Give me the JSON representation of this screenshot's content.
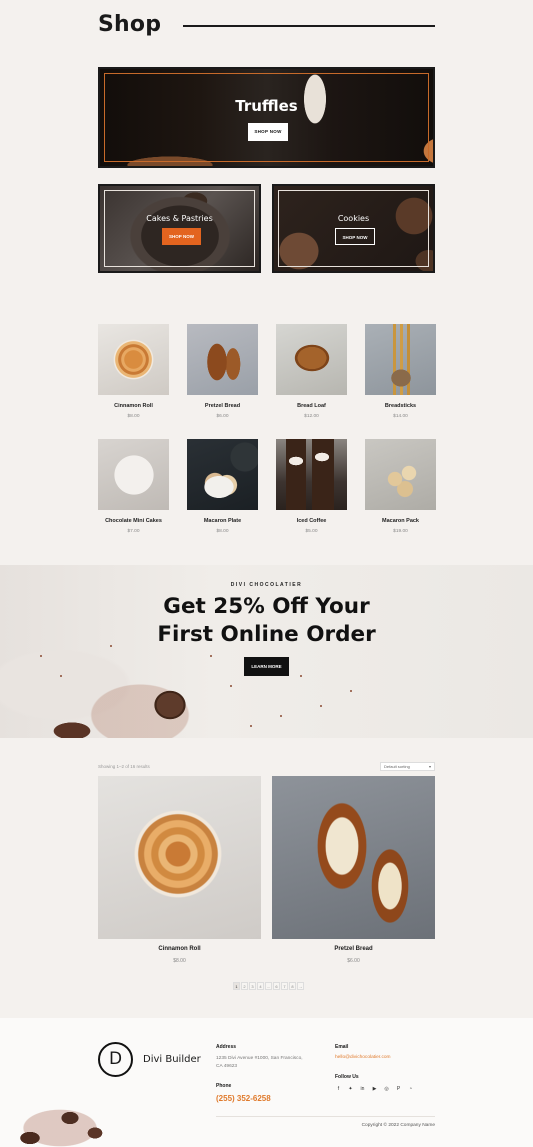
{
  "header": {
    "title": "Shop"
  },
  "banners": {
    "truffles": {
      "title": "Truffles",
      "button": "SHOP NOW"
    },
    "cakes": {
      "title": "Cakes & Pastries",
      "button": "SHOP NOW"
    },
    "cookies": {
      "title": "Cookies",
      "button": "SHOP NOW"
    }
  },
  "products": [
    {
      "name": "Cinnamon Roll",
      "price": "$8.00",
      "image": "cinnamon-roll"
    },
    {
      "name": "Pretzel Bread",
      "price": "$6.00",
      "image": "pretzel-bread"
    },
    {
      "name": "Bread Loaf",
      "price": "$12.00",
      "image": "bread-loaf"
    },
    {
      "name": "Breadsticks",
      "price": "$14.00",
      "image": "breadsticks"
    },
    {
      "name": "Chocolate Mini Cakes",
      "price": "$7.00",
      "image": "chocolate-mini-cakes"
    },
    {
      "name": "Macaron Plate",
      "price": "$8.00",
      "image": "macaron-plate"
    },
    {
      "name": "Iced Coffee",
      "price": "$5.00",
      "image": "iced-coffee"
    },
    {
      "name": "Macaron Pack",
      "price": "$19.00",
      "image": "macaron-pack"
    }
  ],
  "promo": {
    "kicker": "DIVI CHOCOLATIER",
    "headline_line1": "Get 25% Off Your",
    "headline_line2": "First Online Order",
    "button": "LEARN MORE"
  },
  "shop": {
    "result_count": "Showing 1–2 of 16 results",
    "sort_selected": "Default sorting",
    "items": [
      {
        "name": "Cinnamon Roll",
        "price": "$8.00"
      },
      {
        "name": "Pretzel Bread",
        "price": "$6.00"
      }
    ],
    "pagination": [
      "1",
      "2",
      "3",
      "4",
      "…",
      "6",
      "7",
      "8",
      "→"
    ],
    "current_page": "1"
  },
  "footer": {
    "logo_letter": "D",
    "brand": "Divi Builder",
    "address_heading": "Address",
    "address_line1": "1235 Divi Avenue #1000, San Francisco,",
    "address_line2": "CA 49623",
    "phone_heading": "Phone",
    "phone": "(255) 352-6258",
    "email_heading": "Email",
    "email": "hello@divichocolatier.com",
    "follow_heading": "Follow Us",
    "social_icons": [
      "facebook-icon",
      "twitter-icon",
      "linkedin-icon",
      "youtube-icon",
      "instagram-icon",
      "pinterest-icon",
      "rss-icon"
    ],
    "copyright": "Copyright © 2022 Company Name"
  },
  "colors": {
    "accent": "#e3641f",
    "dark": "#111111",
    "background": "#f4f1ee"
  }
}
